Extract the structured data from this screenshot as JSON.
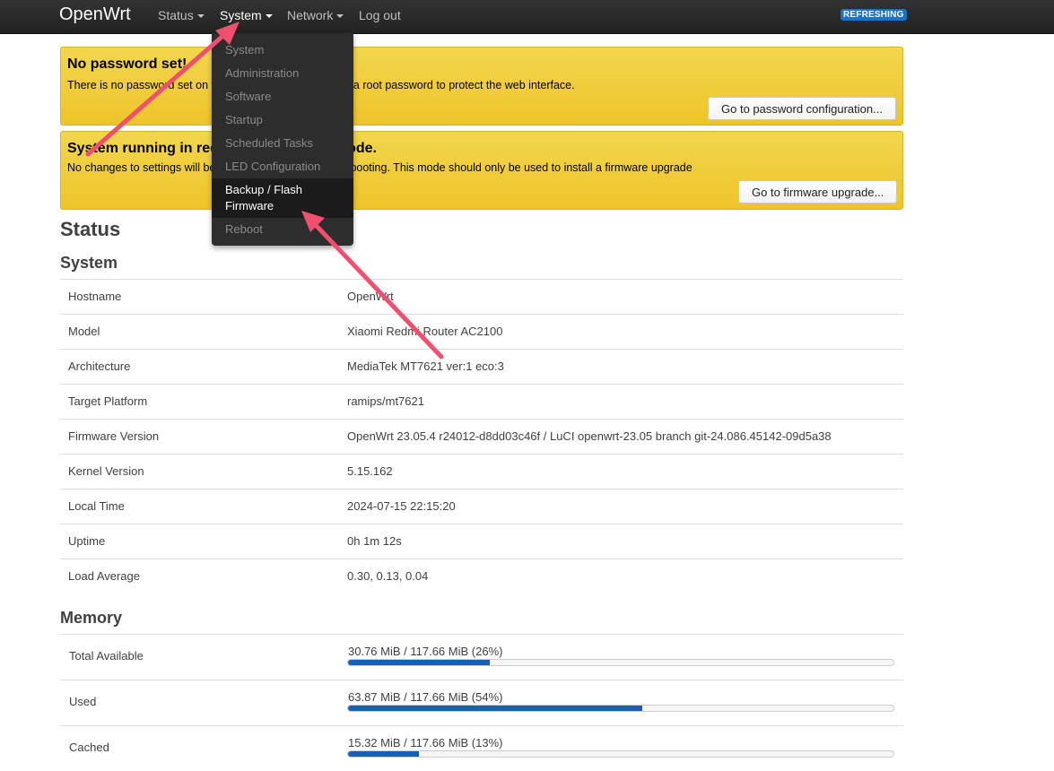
{
  "topbar": {
    "brand": "OpenWrt",
    "nav": [
      {
        "label": "Status",
        "has_caret": true
      },
      {
        "label": "System",
        "has_caret": true
      },
      {
        "label": "Network",
        "has_caret": true
      },
      {
        "label": "Log out",
        "has_caret": false
      }
    ],
    "badge": "REFRESHING"
  },
  "system_menu": {
    "items": [
      "System",
      "Administration",
      "Software",
      "Startup",
      "Scheduled Tasks",
      "LED Configuration",
      "Backup / Flash Firmware",
      "Reboot"
    ],
    "highlighted": "Backup / Flash Firmware",
    "highlighted_lines": [
      "Backup / Flash",
      "Firmware"
    ]
  },
  "alerts": [
    {
      "title": "No password set!",
      "text": "There is no password set on this router. Please configure a root password to protect the web interface.",
      "button": "Go to password configuration..."
    },
    {
      "title": "System running in recovery (initramfs) mode.",
      "text": "No changes to settings will be stored and are lost after rebooting. This mode should only be used to install a firmware upgrade",
      "button": "Go to firmware upgrade..."
    }
  ],
  "page_title": "Status",
  "system_section": {
    "title": "System",
    "rows": [
      {
        "key": "Hostname",
        "value": "OpenWrt"
      },
      {
        "key": "Model",
        "value": "Xiaomi Redmi Router AC2100"
      },
      {
        "key": "Architecture",
        "value": "MediaTek MT7621 ver:1 eco:3"
      },
      {
        "key": "Target Platform",
        "value": "ramips/mt7621"
      },
      {
        "key": "Firmware Version",
        "value": "OpenWrt 23.05.4 r24012-d8dd03c46f / LuCI openwrt-23.05 branch git-24.086.45142-09d5a38"
      },
      {
        "key": "Kernel Version",
        "value": "5.15.162"
      },
      {
        "key": "Local Time",
        "value": "2024-07-15 22:15:20"
      },
      {
        "key": "Uptime",
        "value": "0h 1m 12s"
      },
      {
        "key": "Load Average",
        "value": "0.30, 0.13, 0.04"
      }
    ]
  },
  "memory_section": {
    "title": "Memory",
    "rows": [
      {
        "key": "Total Available",
        "text": "30.76 MiB / 117.66 MiB (26%)",
        "percent": 26
      },
      {
        "key": "Used",
        "text": "63.87 MiB / 117.66 MiB (54%)",
        "percent": 54
      },
      {
        "key": "Cached",
        "text": "15.32 MiB / 117.66 MiB (13%)",
        "percent": 13
      }
    ]
  },
  "colors": {
    "topbar": "#222222",
    "alert": "#eec42a",
    "progress": "#1a5fb4",
    "badge": "#1a73c9",
    "annotation_arrow": "#f0506e"
  }
}
